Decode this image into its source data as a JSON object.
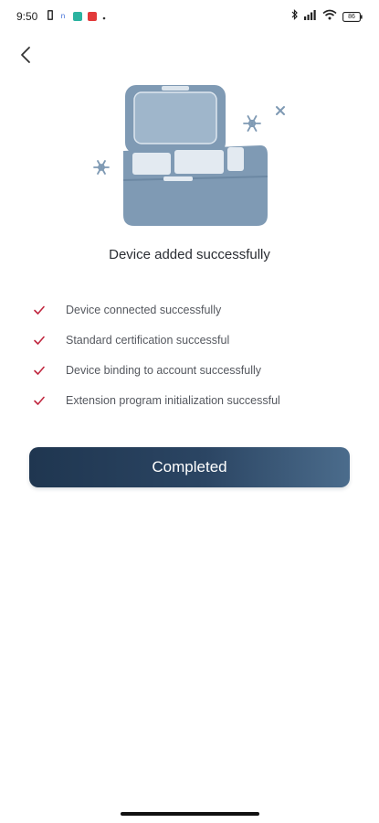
{
  "status_bar": {
    "time": "9:50",
    "battery": "86"
  },
  "icons": {
    "back": "chevron-left-icon",
    "check": "check-icon",
    "device": "cooler-box-illustration",
    "snowflake": "snowflake-icon"
  },
  "colors": {
    "accent_check": "#c0273f",
    "button_start": "#1f3650",
    "button_end": "#4b6c8c",
    "illustration": "#7f9ab4"
  },
  "header": {
    "title": "Device added successfully"
  },
  "steps": [
    {
      "label": "Device connected successfully"
    },
    {
      "label": "Standard certification successful"
    },
    {
      "label": "Device binding to account successfully"
    },
    {
      "label": "Extension program initialization successful"
    }
  ],
  "actions": {
    "completed_label": "Completed"
  }
}
